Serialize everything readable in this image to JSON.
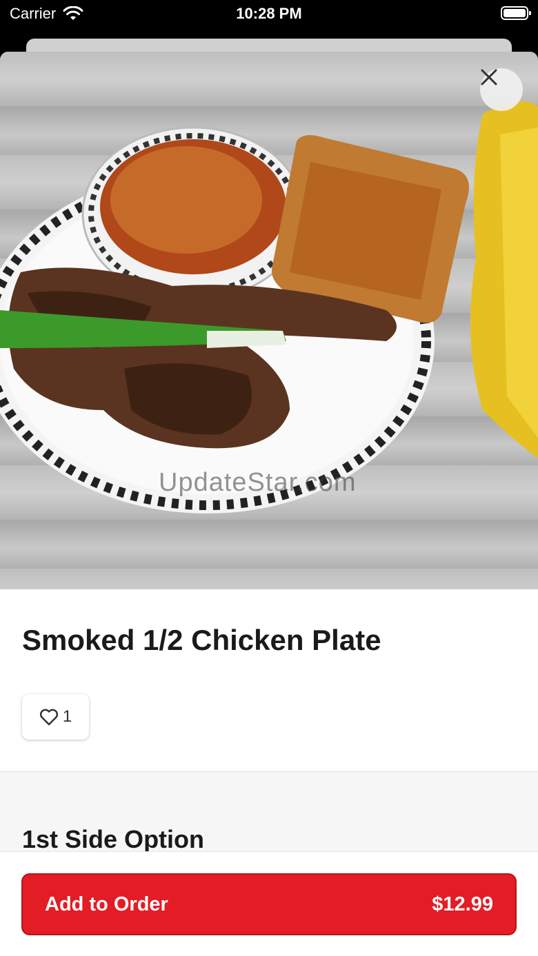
{
  "status_bar": {
    "carrier": "Carrier",
    "time": "10:28 PM"
  },
  "hero": {
    "watermark": "UpdateStar.com"
  },
  "item": {
    "title": "Smoked 1/2 Chicken Plate",
    "likes": "1"
  },
  "options": {
    "section_title": "1st Side Option"
  },
  "footer": {
    "add_label": "Add to Order",
    "price": "$12.99"
  },
  "colors": {
    "accent": "#e31c25"
  },
  "icons": {
    "close": "close-icon",
    "like": "heart-icon",
    "wifi": "wifi-icon",
    "battery": "battery-icon"
  }
}
